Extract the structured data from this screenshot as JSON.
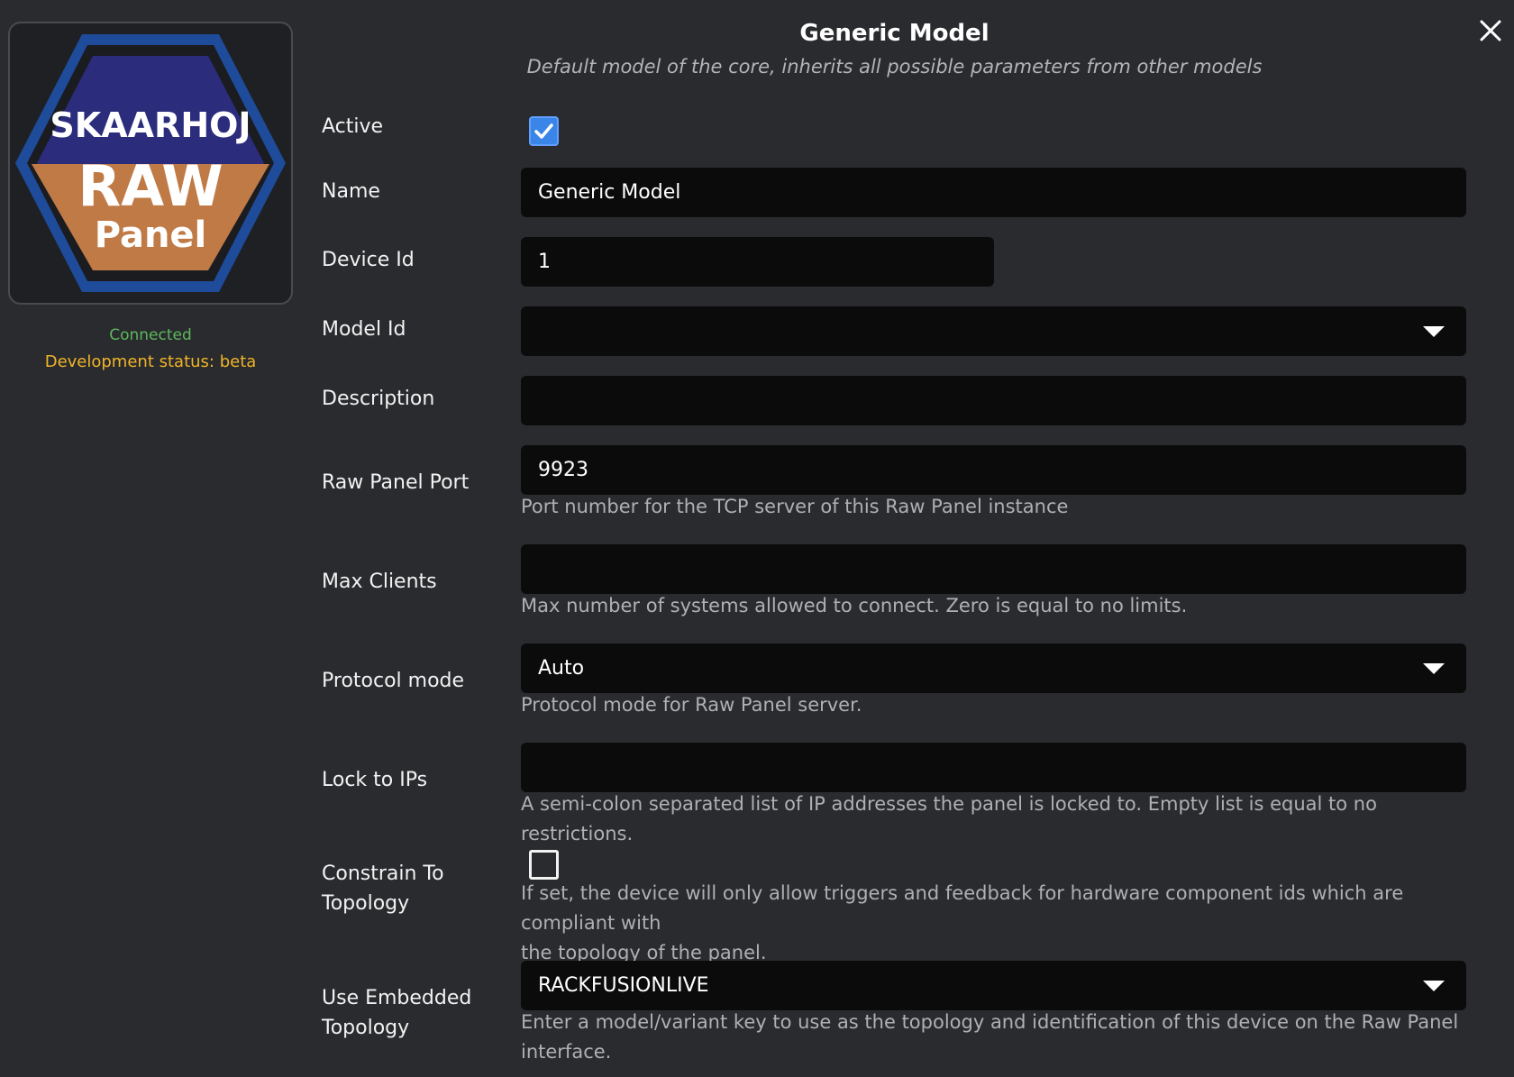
{
  "logo": {
    "line1": "SKAARHOJ",
    "line2": "RAW",
    "line3": "Panel",
    "colors": {
      "ring": "#1e4b9a",
      "top": "#2b2c7c",
      "bottom": "#c07a46"
    }
  },
  "status": {
    "connected": "Connected",
    "development": "Development status: beta"
  },
  "header": {
    "title": "Generic Model",
    "subtitle": "Default model of the core, inherits all possible parameters from other models"
  },
  "form": {
    "active": {
      "label": "Active",
      "checked": true
    },
    "name": {
      "label": "Name",
      "value": "Generic Model"
    },
    "device_id": {
      "label": "Device Id",
      "value": "1"
    },
    "model_id": {
      "label": "Model Id",
      "value": ""
    },
    "description": {
      "label": "Description",
      "value": ""
    },
    "raw_panel_port": {
      "label": "Raw Panel Port",
      "value": "9923",
      "help": "Port number for the TCP server of this Raw Panel instance"
    },
    "max_clients": {
      "label": "Max Clients",
      "value": "",
      "help": "Max number of systems allowed to connect. Zero is equal to no limits."
    },
    "protocol_mode": {
      "label": "Protocol mode",
      "value": "Auto",
      "help": "Protocol mode for Raw Panel server."
    },
    "lock_to_ips": {
      "label": "Lock to IPs",
      "value": "",
      "help": "A semi-colon separated list of IP addresses the panel is locked to. Empty list is equal to no restrictions."
    },
    "constrain_to_topology": {
      "label_line1": "Constrain To",
      "label_line2": "Topology",
      "checked": false,
      "help_line1": "If set, the device will only allow triggers and feedback for hardware component ids which are compliant with",
      "help_line2": "the topology of the panel."
    },
    "use_embedded_topology": {
      "label_line1": "Use Embedded",
      "label_line2": "Topology",
      "value": "RACKFUSIONLIVE",
      "help_line1": "Enter a model/variant key to use as the topology and identification of this device on the Raw Panel",
      "help_line2": "interface."
    }
  },
  "icons": {
    "close": "close-icon",
    "checkmark": "checkmark-icon",
    "dropdown": "chevron-down-icon"
  },
  "colors": {
    "background": "#2a2b2e",
    "input": "#0b0b0c",
    "accent": "#3a86e8",
    "connected": "#5cb85c",
    "beta": "#f0b429"
  }
}
